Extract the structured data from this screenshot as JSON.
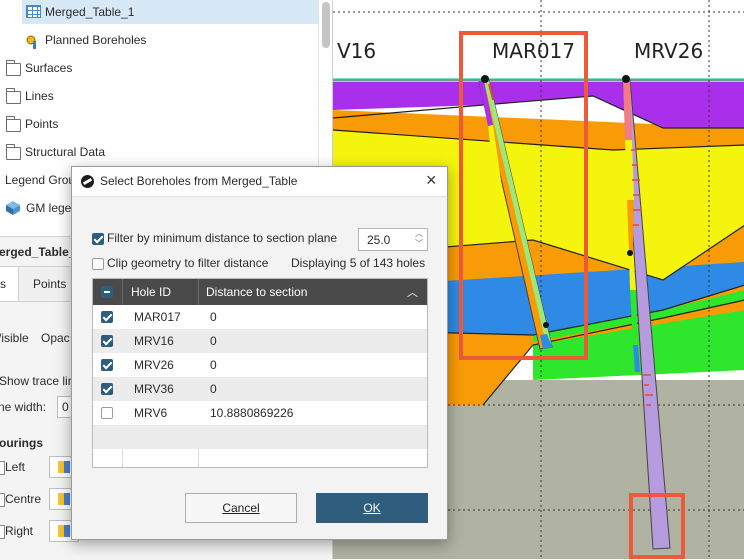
{
  "tree": {
    "items": [
      {
        "label": "Merged_Table_1",
        "icon": "table-icon"
      },
      {
        "label": "Planned Boreholes",
        "icon": "planned-borehole-icon"
      },
      {
        "label": "Surfaces",
        "icon": "folder-icon"
      },
      {
        "label": "Lines",
        "icon": "folder-icon"
      },
      {
        "label": "Points",
        "icon": "folder-icon"
      },
      {
        "label": "Structural Data",
        "icon": "folder-icon"
      },
      {
        "label": "Legend Grou",
        "icon": ""
      },
      {
        "label": "GM lege",
        "icon": "gm-legend-icon"
      },
      {
        "label": "erged_Table_",
        "icon": ""
      }
    ]
  },
  "props": {
    "tabs": [
      "s",
      "Points "
    ],
    "visible_label": "/isible",
    "opacity_label": "Opac",
    "show_trace_label": "Show trace lin",
    "line_width_label": "ne width:",
    "line_width_value": "0",
    "colourings_label": "ourings",
    "left_label": "Left",
    "centre_label": "Centre",
    "right_label": "Right"
  },
  "section": {
    "labels": [
      "V16",
      "MAR017",
      "MRV26"
    ],
    "colors": {
      "purple": "#a92fea",
      "yellow": "#f4f40d",
      "orange": "#f99b06",
      "blue": "#2f8ae6",
      "green": "#2ee62b",
      "grey": "#b0b3a1",
      "highlight": "#ed5a3a"
    }
  },
  "dialog": {
    "title": "Select Boreholes from Merged_Table",
    "filter_label": "Filter by minimum distance to section plane",
    "filter_value": "25.0",
    "clip_label": "Clip geometry to filter distance",
    "status": "Displaying 5 of 143 holes",
    "columns": {
      "hole_id": "Hole ID",
      "distance": "Distance to section"
    },
    "rows": [
      {
        "hole_id": "MAR017",
        "distance": "0",
        "checked": true
      },
      {
        "hole_id": "MRV16",
        "distance": "0",
        "checked": true
      },
      {
        "hole_id": "MRV26",
        "distance": "0",
        "checked": true
      },
      {
        "hole_id": "MRV36",
        "distance": "0",
        "checked": true
      },
      {
        "hole_id": "MRV6",
        "distance": "10.8880869226",
        "checked": false
      }
    ],
    "cancel_label": "Cancel",
    "ok_label": "OK"
  }
}
